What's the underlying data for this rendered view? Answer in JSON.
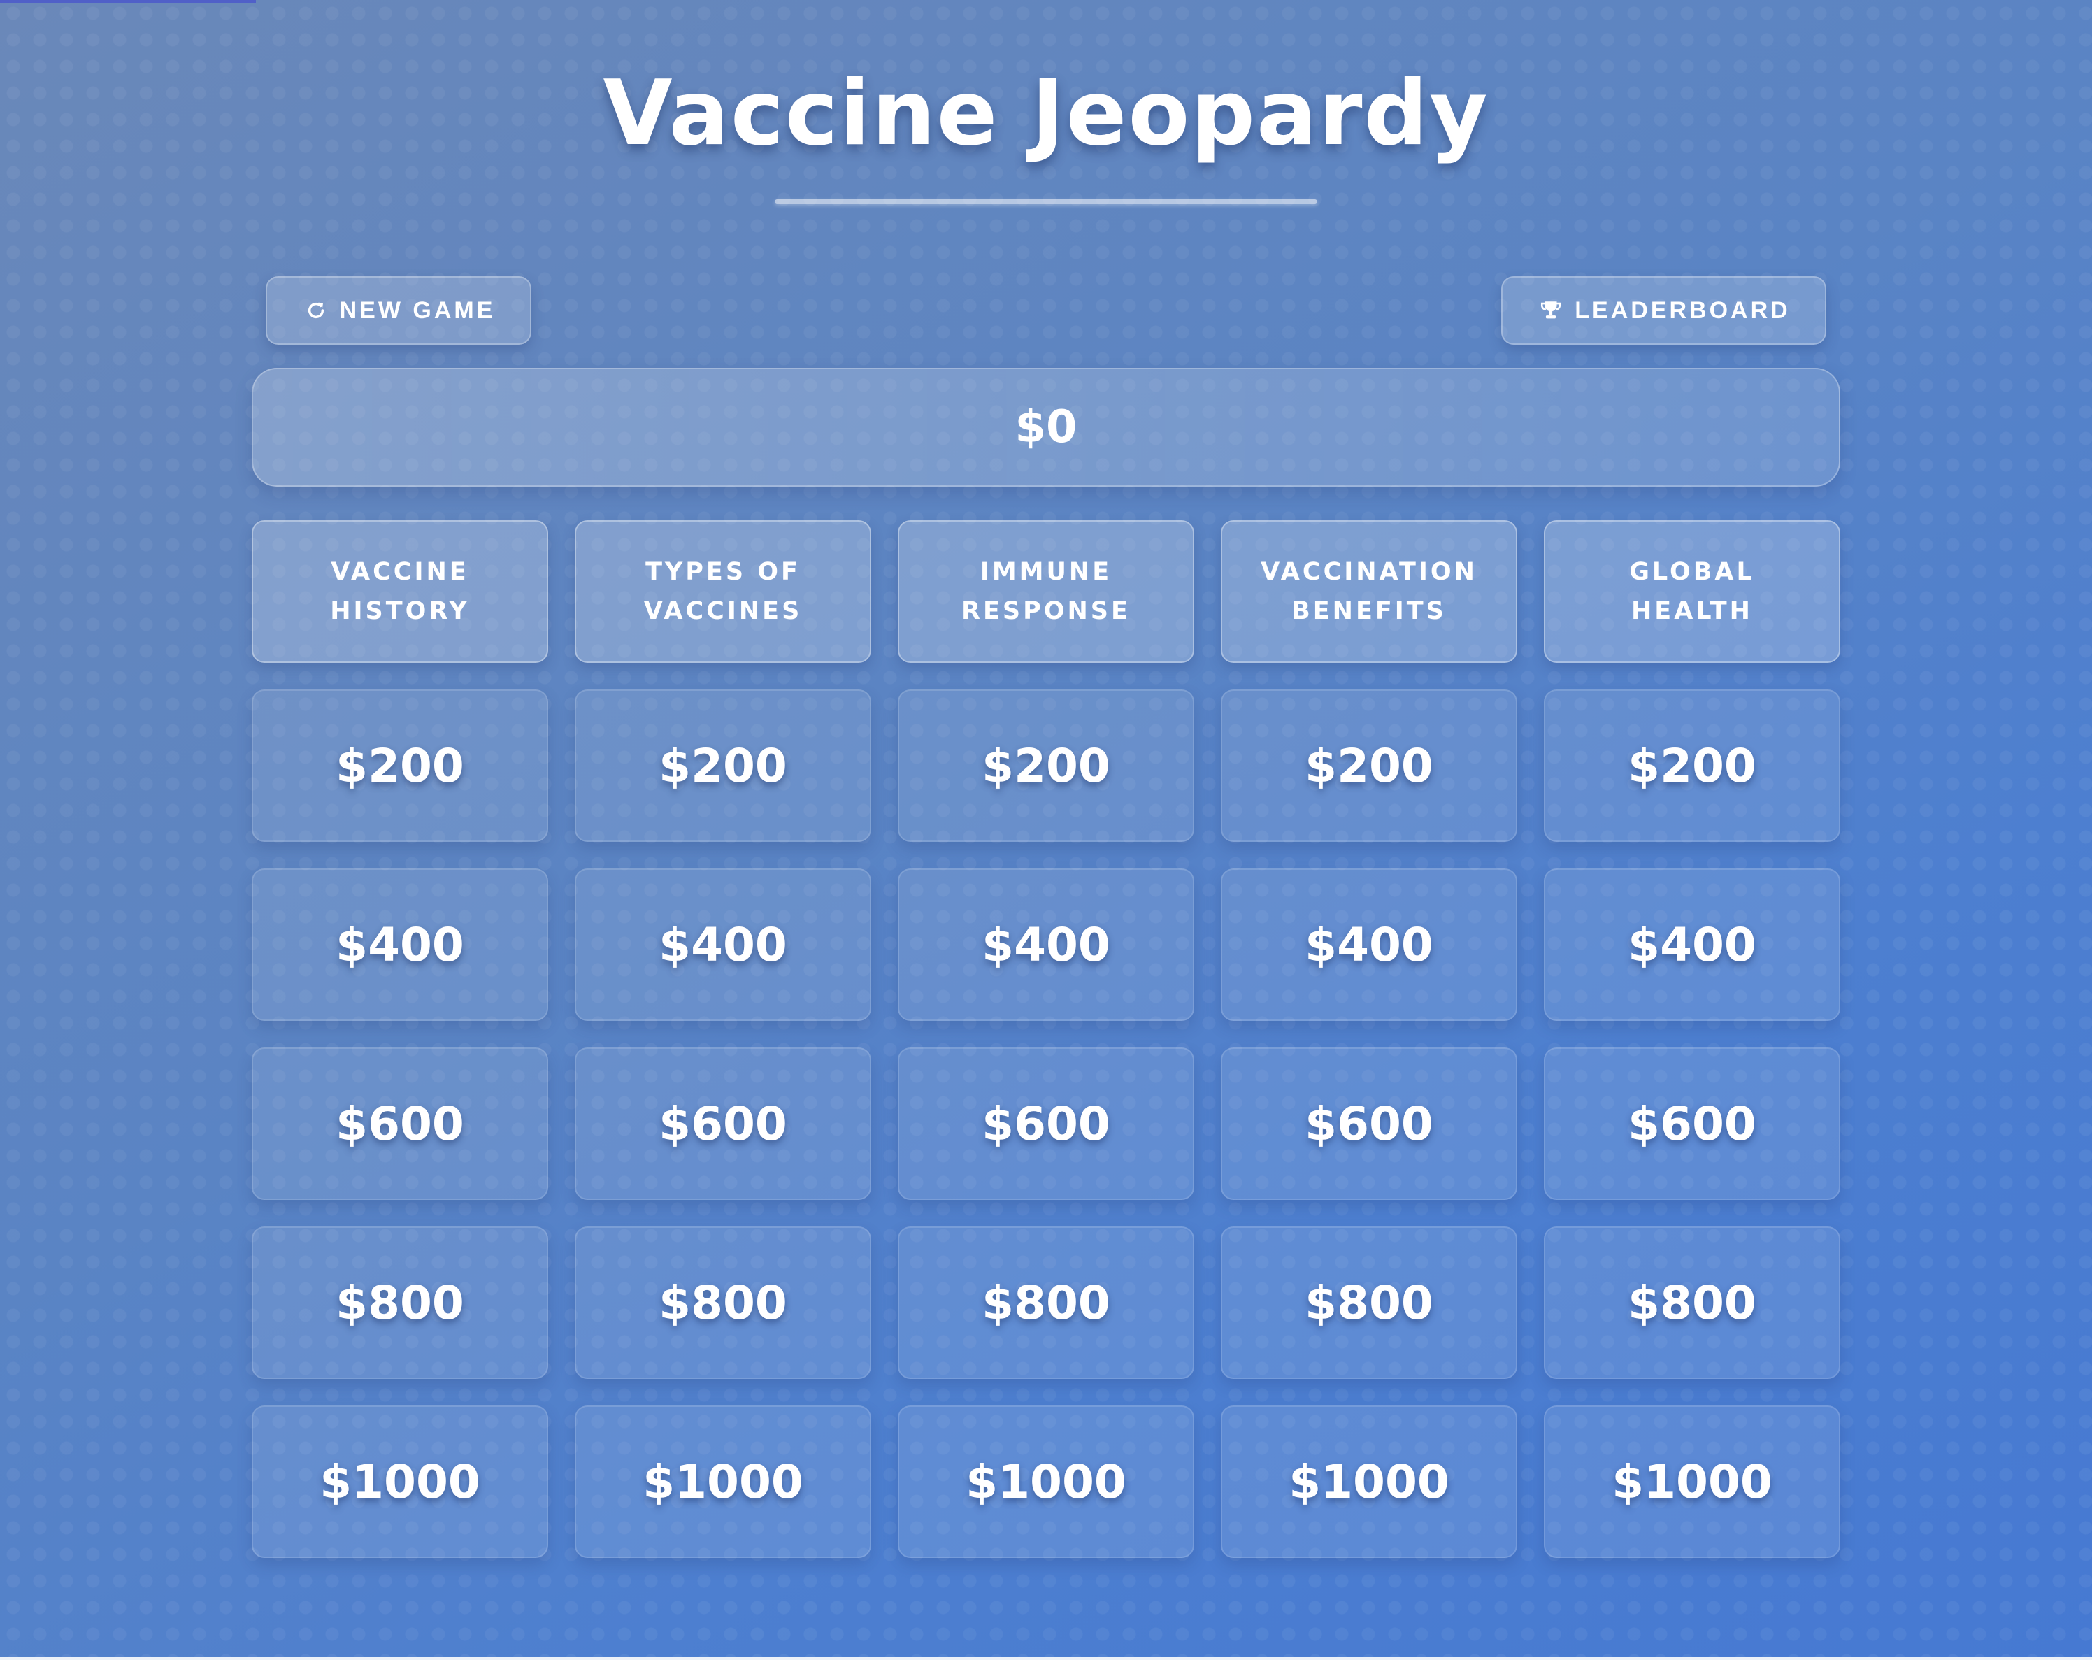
{
  "title": "Vaccine Jeopardy",
  "controls": {
    "new_game_label": "NEW GAME",
    "new_game_icon": "refresh-icon",
    "leaderboard_label": "LEADERBOARD",
    "leaderboard_icon": "trophy-icon"
  },
  "score": "$0",
  "colors": {
    "background_start": "#6a88b9",
    "background_end": "#4679d2",
    "text": "#ffffff"
  },
  "categories": [
    {
      "line1": "VACCINE",
      "line2": "HISTORY"
    },
    {
      "line1": "TYPES OF",
      "line2": "VACCINES"
    },
    {
      "line1": "IMMUNE",
      "line2": "RESPONSE"
    },
    {
      "line1": "VACCINATION",
      "line2": "BENEFITS"
    },
    {
      "line1": "GLOBAL",
      "line2": "HEALTH"
    }
  ],
  "rows": [
    [
      "$200",
      "$200",
      "$200",
      "$200",
      "$200"
    ],
    [
      "$400",
      "$400",
      "$400",
      "$400",
      "$400"
    ],
    [
      "$600",
      "$600",
      "$600",
      "$600",
      "$600"
    ],
    [
      "$800",
      "$800",
      "$800",
      "$800",
      "$800"
    ],
    [
      "$1000",
      "$1000",
      "$1000",
      "$1000",
      "$1000"
    ]
  ]
}
